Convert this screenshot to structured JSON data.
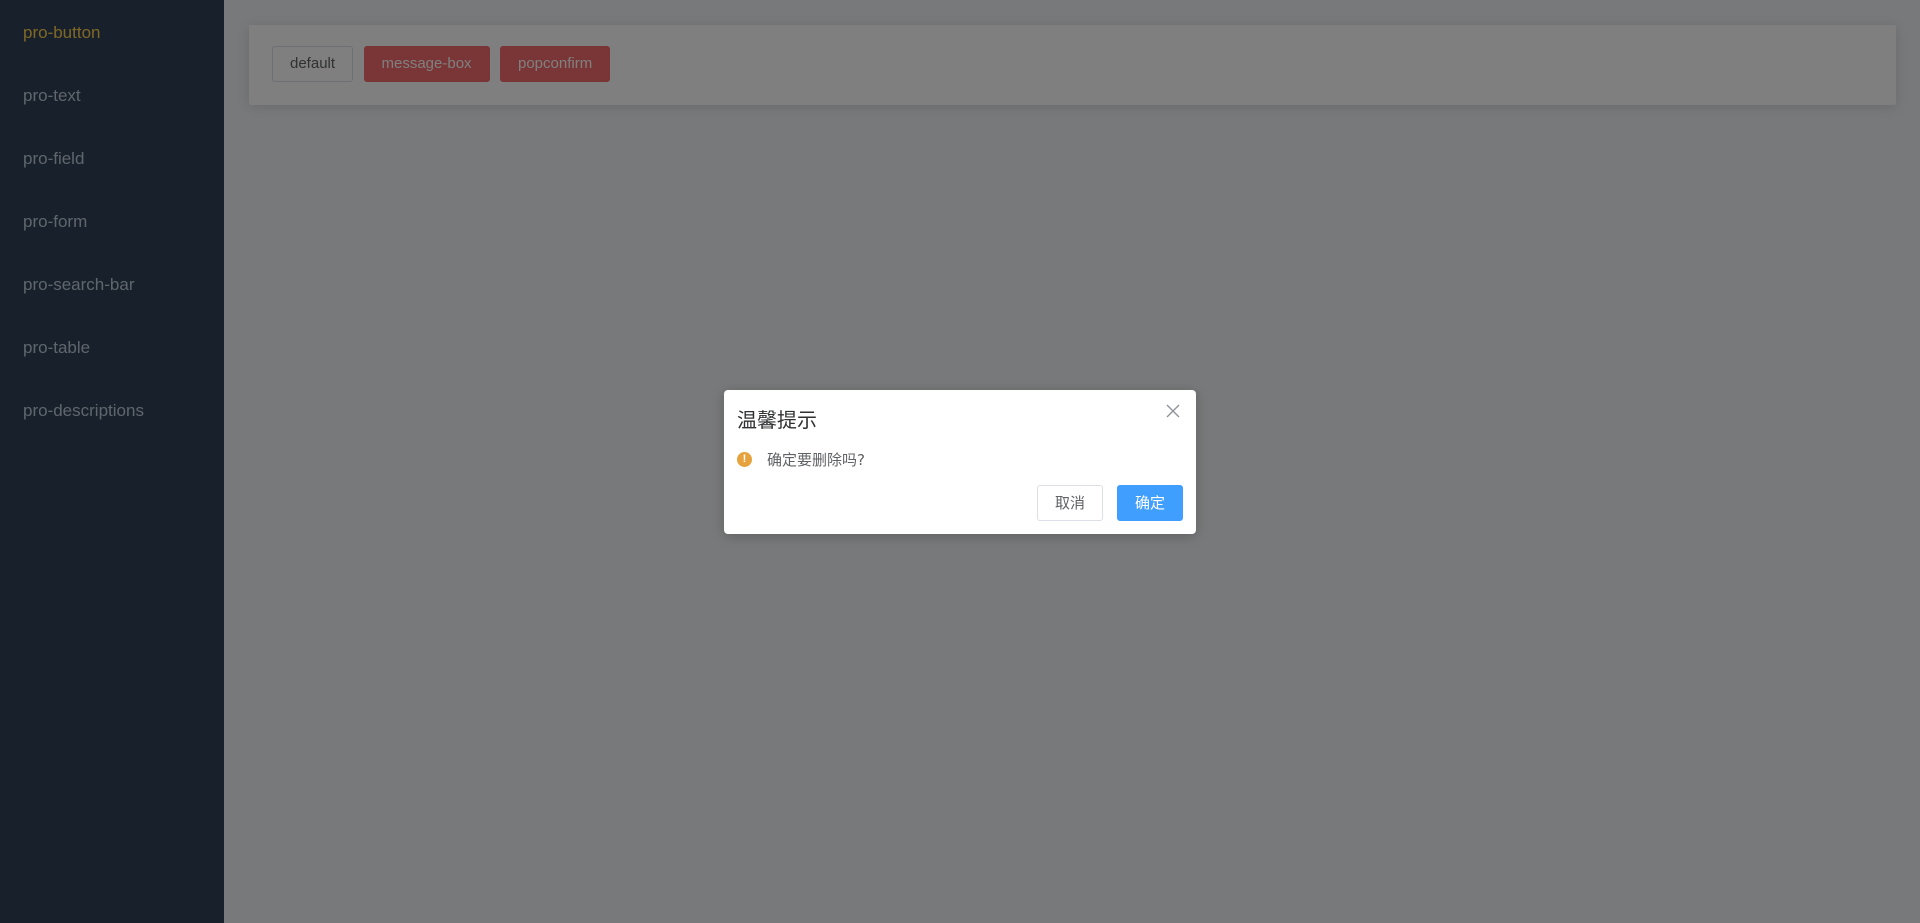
{
  "sidebar": {
    "items": [
      {
        "label": "pro-button"
      },
      {
        "label": "pro-text"
      },
      {
        "label": "pro-field"
      },
      {
        "label": "pro-form"
      },
      {
        "label": "pro-search-bar"
      },
      {
        "label": "pro-table"
      },
      {
        "label": "pro-descriptions"
      }
    ],
    "active_index": 0
  },
  "toolbar": {
    "default_label": "default",
    "message_box_label": "message-box",
    "popconfirm_label": "popconfirm"
  },
  "dialog": {
    "title": "温馨提示",
    "message": "确定要删除吗?",
    "icon": "warning-icon",
    "cancel_label": "取消",
    "confirm_label": "确定"
  },
  "colors": {
    "sidebar_bg": "#304156",
    "sidebar_text": "#bfcbd9",
    "sidebar_active": "#ffd04b",
    "danger": "#f56c6c",
    "primary": "#409eff",
    "warning": "#e6a23c"
  }
}
